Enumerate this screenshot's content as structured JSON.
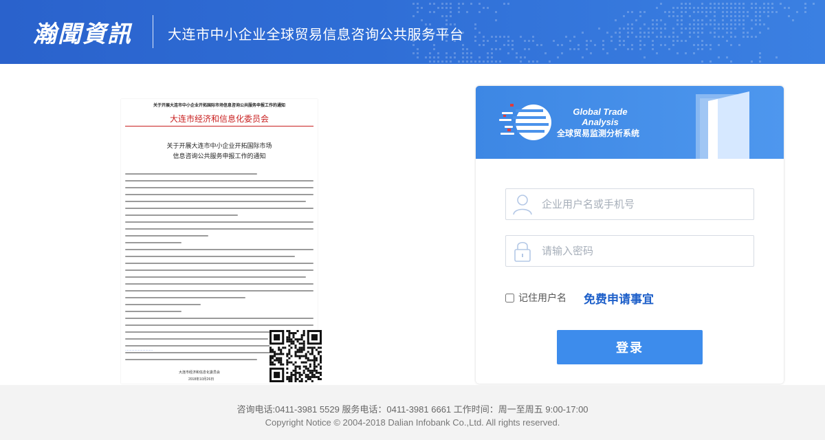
{
  "header": {
    "brand": "瀚聞資訊",
    "title": "大连市中小企业全球贸易信息咨询公共服务平台"
  },
  "notice": {
    "top_title": "关于开展大连市中小企业开拓国际市场信息咨询公共服务申报工作的通知",
    "org": "大连市经济和信息化委员会",
    "heading_line1": "关于开展大连市中小企业开拓国际市场",
    "heading_line2": "信息咨询公共服务申报工作的通知",
    "sign_org": "大连市经济和信息化委员会",
    "sign_date": "2018年10月26日"
  },
  "banner": {
    "title_en_line1": "Global Trade",
    "title_en_line2": "Analysis",
    "title_cn": "全球贸易监测分析系统"
  },
  "login": {
    "username_placeholder": "企业用户名或手机号",
    "password_placeholder": "请输入密码",
    "remember_label": "记住用户名",
    "apply_link": "免费申请事宜",
    "submit_label": "登录"
  },
  "footer": {
    "line1": "咨询电话:0411-3981 5529 服务电话：0411-3981 6661 工作时间：周一至周五 9:00-17:00",
    "line2": "Copyright Notice © 2004-2018 Dalian Infobank Co.,Ltd. All rights reserved."
  },
  "icons": {
    "user": "user-icon",
    "lock": "lock-icon",
    "globe": "globe-logo-icon",
    "door": "door-icon",
    "qr": "qr-code-icon"
  },
  "colors": {
    "header_blue": "#2f6ed6",
    "banner_blue": "#4a92eb",
    "button_blue": "#3d8cec",
    "link_blue": "#1d5fc9"
  }
}
